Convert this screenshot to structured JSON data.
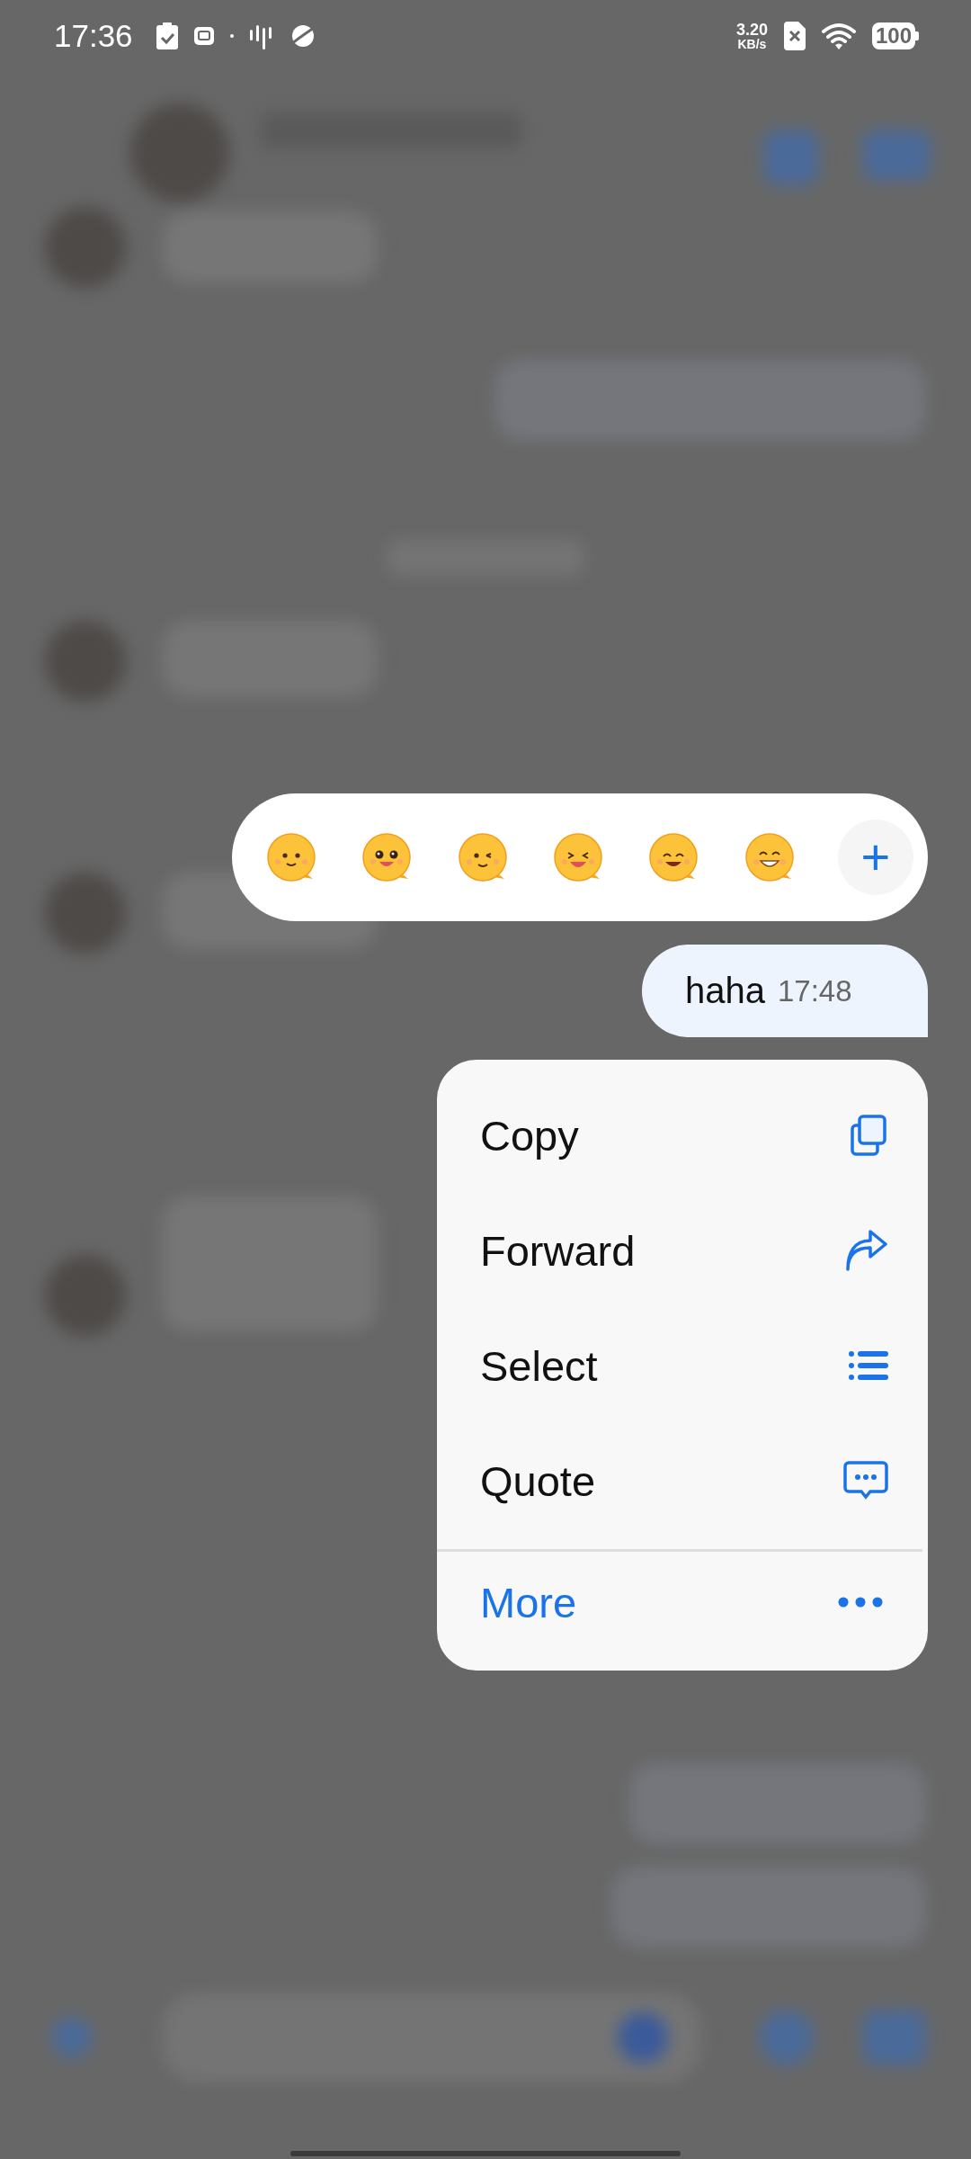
{
  "status_bar": {
    "time": "17:36",
    "speed_value": "3.20",
    "speed_unit": "KB/s",
    "battery": "100"
  },
  "reaction_bar": {
    "more_button": "+"
  },
  "message": {
    "text": "haha",
    "time": "17:48"
  },
  "context_menu": {
    "items": [
      {
        "label": "Copy",
        "kind": "copy"
      },
      {
        "label": "Forward",
        "kind": "forward"
      },
      {
        "label": "Select",
        "kind": "select"
      },
      {
        "label": "Quote",
        "kind": "quote"
      },
      {
        "label": "More",
        "kind": "more"
      }
    ]
  }
}
